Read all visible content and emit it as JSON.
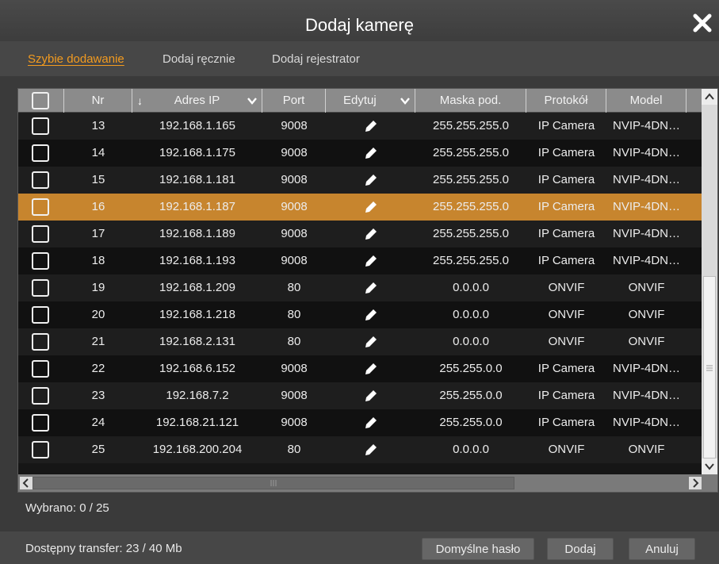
{
  "dialog": {
    "title": "Dodaj kamerę",
    "close_icon": "close-icon"
  },
  "tabs": [
    {
      "label": "Szybie dodawanie",
      "active": true
    },
    {
      "label": "Dodaj ręcznie",
      "active": false
    },
    {
      "label": "Dodaj rejestrator",
      "active": false
    }
  ],
  "table": {
    "columns": [
      "Nr",
      "Adres IP",
      "Port",
      "Edytuj",
      "Maska pod.",
      "Protokół",
      "Model"
    ],
    "rows": [
      {
        "nr": "13",
        "ip": "192.168.1.165",
        "port": "9008",
        "mask": "255.255.255.0",
        "protocol": "IP Camera",
        "model": "NVIP-4DN…",
        "selected": false
      },
      {
        "nr": "14",
        "ip": "192.168.1.175",
        "port": "9008",
        "mask": "255.255.255.0",
        "protocol": "IP Camera",
        "model": "NVIP-4DN…",
        "selected": false
      },
      {
        "nr": "15",
        "ip": "192.168.1.181",
        "port": "9008",
        "mask": "255.255.255.0",
        "protocol": "IP Camera",
        "model": "NVIP-4DN…",
        "selected": false
      },
      {
        "nr": "16",
        "ip": "192.168.1.187",
        "port": "9008",
        "mask": "255.255.255.0",
        "protocol": "IP Camera",
        "model": "NVIP-4DN…",
        "selected": true
      },
      {
        "nr": "17",
        "ip": "192.168.1.189",
        "port": "9008",
        "mask": "255.255.255.0",
        "protocol": "IP Camera",
        "model": "NVIP-4DN…",
        "selected": false
      },
      {
        "nr": "18",
        "ip": "192.168.1.193",
        "port": "9008",
        "mask": "255.255.255.0",
        "protocol": "IP Camera",
        "model": "NVIP-4DN…",
        "selected": false
      },
      {
        "nr": "19",
        "ip": "192.168.1.209",
        "port": "80",
        "mask": "0.0.0.0",
        "protocol": "ONVIF",
        "model": "ONVIF",
        "selected": false
      },
      {
        "nr": "20",
        "ip": "192.168.1.218",
        "port": "80",
        "mask": "0.0.0.0",
        "protocol": "ONVIF",
        "model": "ONVIF",
        "selected": false
      },
      {
        "nr": "21",
        "ip": "192.168.2.131",
        "port": "80",
        "mask": "0.0.0.0",
        "protocol": "ONVIF",
        "model": "ONVIF",
        "selected": false
      },
      {
        "nr": "22",
        "ip": "192.168.6.152",
        "port": "9008",
        "mask": "255.255.0.0",
        "protocol": "IP Camera",
        "model": "NVIP-4DN…",
        "selected": false
      },
      {
        "nr": "23",
        "ip": "192.168.7.2",
        "port": "9008",
        "mask": "255.255.0.0",
        "protocol": "IP Camera",
        "model": "NVIP-4DN…",
        "selected": false
      },
      {
        "nr": "24",
        "ip": "192.168.21.121",
        "port": "9008",
        "mask": "255.255.0.0",
        "protocol": "IP Camera",
        "model": "NVIP-4DN…",
        "selected": false
      },
      {
        "nr": "25",
        "ip": "192.168.200.204",
        "port": "80",
        "mask": "0.0.0.0",
        "protocol": "ONVIF",
        "model": "ONVIF",
        "selected": false
      }
    ]
  },
  "status": {
    "selected_text": "Wybrano: 0 / 25",
    "transfer_text": "Dostępny transfer: 23 / 40 Mb"
  },
  "buttons": {
    "default_password": "Domyślne hasło",
    "add": "Dodaj",
    "cancel": "Anuluj"
  },
  "colors": {
    "accent": "#f39b1f",
    "selected_row": "#c7852e"
  }
}
